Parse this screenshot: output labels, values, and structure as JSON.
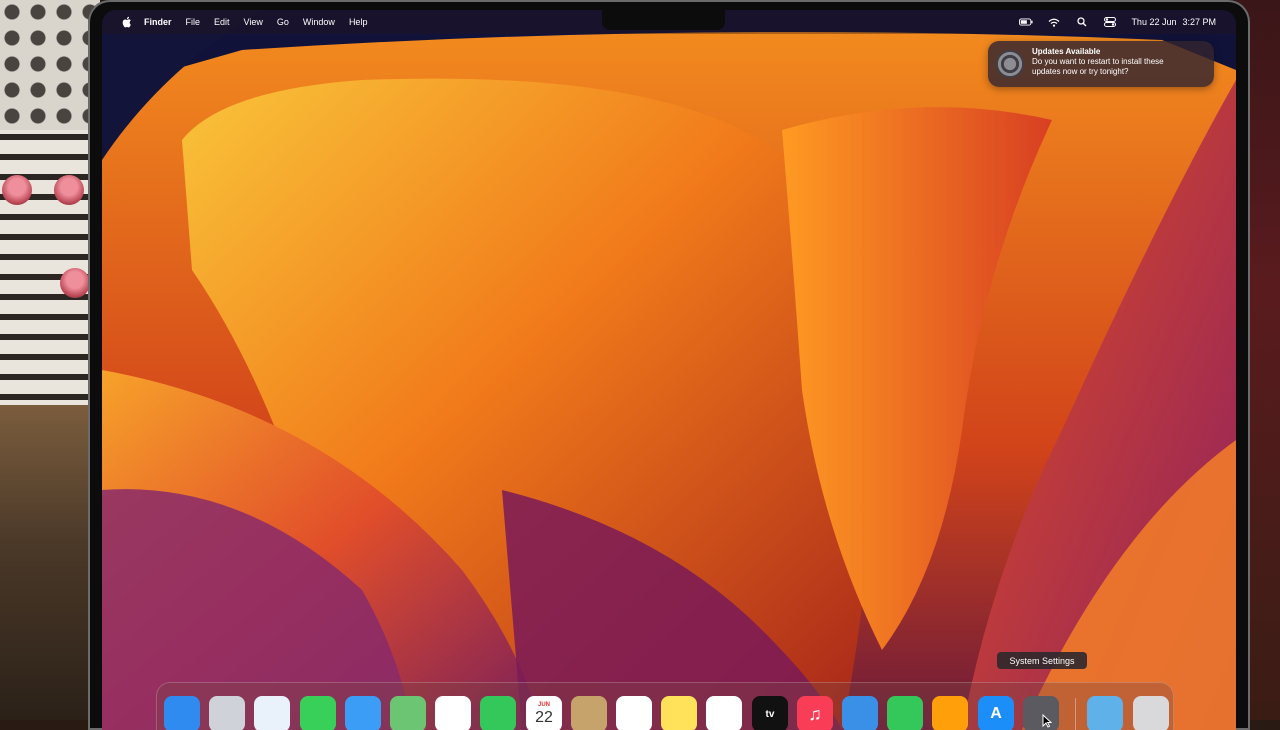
{
  "menubar": {
    "app": "Finder",
    "menus": [
      "File",
      "Edit",
      "View",
      "Go",
      "Window",
      "Help"
    ],
    "status_icons": [
      "battery-icon",
      "wifi-icon",
      "spotlight-search-icon",
      "control-center-icon"
    ],
    "date": "Thu 22 Jun",
    "time": "3:27 PM"
  },
  "notification": {
    "title": "Updates Available",
    "body_line1": "Do you want to restart to install these",
    "body_line2": "updates now or try tonight?",
    "icon": "system-settings-gear-icon"
  },
  "tooltip": "System Settings",
  "dock": {
    "apps": [
      {
        "name": "finder-icon",
        "label": "",
        "bg": "#2f8bf0"
      },
      {
        "name": "launchpad-icon",
        "label": "",
        "bg": "#cfd2d8"
      },
      {
        "name": "safari-icon",
        "label": "",
        "bg": "#e9f1fb"
      },
      {
        "name": "messages-icon",
        "label": "",
        "bg": "#39d05a"
      },
      {
        "name": "mail-icon",
        "label": "",
        "bg": "#3b9df5"
      },
      {
        "name": "maps-icon",
        "label": "",
        "bg": "#6bc572"
      },
      {
        "name": "photos-icon",
        "label": "",
        "bg": "#ffffff"
      },
      {
        "name": "facetime-icon",
        "label": "",
        "bg": "#34c759"
      },
      {
        "name": "calendar-icon",
        "label": "22",
        "month": "JUN",
        "bg": "#ffffff"
      },
      {
        "name": "contacts-icon",
        "label": "",
        "bg": "#c6a36a"
      },
      {
        "name": "reminders-icon",
        "label": "",
        "bg": "#ffffff"
      },
      {
        "name": "notes-icon",
        "label": "",
        "bg": "#ffe25a"
      },
      {
        "name": "freeform-icon",
        "label": "",
        "bg": "#ffffff"
      },
      {
        "name": "apple-tv-icon",
        "label": "tv",
        "bg": "#111111"
      },
      {
        "name": "music-icon",
        "label": "♫",
        "bg": "#fa3d57"
      },
      {
        "name": "keynote-icon",
        "label": "",
        "bg": "#3a8fe6"
      },
      {
        "name": "numbers-icon",
        "label": "",
        "bg": "#34c759"
      },
      {
        "name": "pages-icon",
        "label": "",
        "bg": "#ff9f0a"
      },
      {
        "name": "app-store-icon",
        "label": "A",
        "bg": "#1c8ef9"
      },
      {
        "name": "system-settings-icon",
        "label": "",
        "bg": "#5a5a60"
      }
    ],
    "right": [
      {
        "name": "downloads-folder-icon",
        "bg": "#5fb1ea"
      },
      {
        "name": "trash-icon",
        "bg": "#d9d9dc"
      }
    ]
  }
}
